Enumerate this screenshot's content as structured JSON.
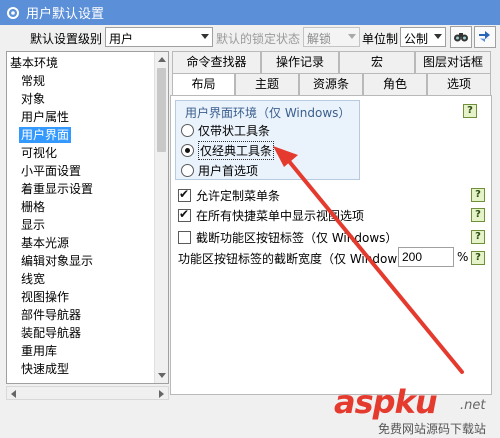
{
  "window": {
    "title": "用户默认设置"
  },
  "toolbar": {
    "level_label": "默认设置级别",
    "level_value": "用户",
    "lock_label": "默认的锁定状态",
    "lock_value": "解锁",
    "unit_label": "单位制",
    "unit_value": "公制"
  },
  "tree": {
    "items": [
      {
        "label": "基本环境",
        "type": "root"
      },
      {
        "label": "常规",
        "type": "child"
      },
      {
        "label": "对象",
        "type": "child"
      },
      {
        "label": "用户属性",
        "type": "child"
      },
      {
        "label": "用户界面",
        "type": "child",
        "selected": true
      },
      {
        "label": "可视化",
        "type": "child"
      },
      {
        "label": "小平面设置",
        "type": "child"
      },
      {
        "label": "着重显示设置",
        "type": "child"
      },
      {
        "label": "栅格",
        "type": "child"
      },
      {
        "label": "显示",
        "type": "child"
      },
      {
        "label": "基本光源",
        "type": "child"
      },
      {
        "label": "编辑对象显示",
        "type": "child"
      },
      {
        "label": "线宽",
        "type": "child"
      },
      {
        "label": "视图操作",
        "type": "child"
      },
      {
        "label": "部件导航器",
        "type": "child"
      },
      {
        "label": "装配导航器",
        "type": "child"
      },
      {
        "label": "重用库",
        "type": "child"
      },
      {
        "label": "快速成型",
        "type": "child"
      }
    ]
  },
  "tabs": {
    "row1": [
      "命令查找器",
      "操作记录",
      "宏",
      "图层对话框"
    ],
    "row2": [
      "布局",
      "主题",
      "资源条",
      "角色",
      "选项"
    ],
    "active": "布局"
  },
  "ui_env": {
    "title": "用户界面环境（仅 Windows）",
    "options": [
      "仅带状工具条",
      "仅经典工具条",
      "用户首选项"
    ],
    "selected": "仅经典工具条"
  },
  "checks": [
    {
      "label": "允许定制菜单条",
      "checked": true
    },
    {
      "label": "在所有快捷菜单中显示视图选项",
      "checked": true
    },
    {
      "label": "截断功能区按钮标签（仅 Windows）",
      "checked": false
    }
  ],
  "truncate_width": {
    "label": "功能区按钮标签的截断宽度（仅 Windows）",
    "value": "200",
    "unit": "%"
  },
  "help_icon": "?",
  "watermark": {
    "main": "aspku",
    "suffix": ".net",
    "sub": "免费网站源码下载站"
  },
  "colors": {
    "titlebar": "#5b8fd8",
    "selection": "#3399ff",
    "arrow": "#e53a2e"
  }
}
